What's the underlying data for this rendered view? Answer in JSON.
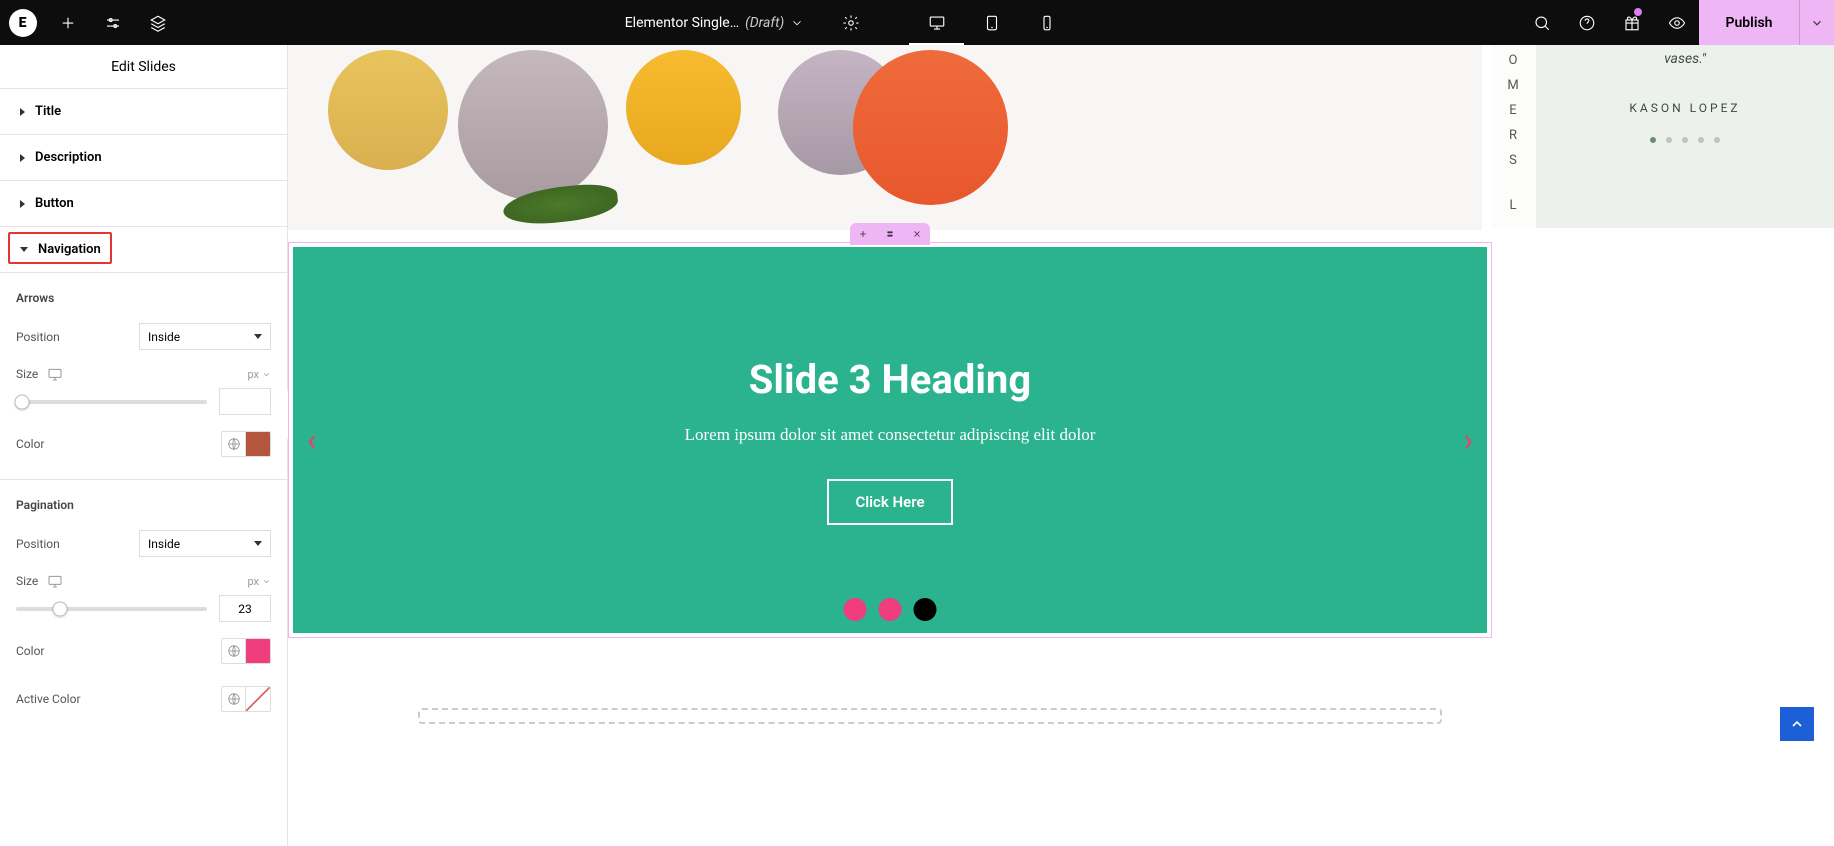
{
  "topbar": {
    "logo": "E",
    "title": "Elementor Single…",
    "status": "(Draft)",
    "publish": "Publish"
  },
  "sidebar": {
    "title": "Edit Slides",
    "accordions": {
      "title": "Title",
      "description": "Description",
      "button": "Button",
      "navigation": "Navigation"
    },
    "arrows": {
      "heading": "Arrows",
      "position_label": "Position",
      "position_value": "Inside",
      "size_label": "Size",
      "size_unit": "px",
      "size_value": "",
      "color_label": "Color",
      "color_hex": "#b4563d"
    },
    "pagination": {
      "heading": "Pagination",
      "position_label": "Position",
      "position_value": "Inside",
      "size_label": "Size",
      "size_unit": "px",
      "size_value": "23",
      "color_label": "Color",
      "color_hex": "#ef3d7e",
      "active_color_label": "Active Color"
    }
  },
  "slide": {
    "heading": "Slide 3 Heading",
    "text": "Lorem ipsum dolor sit amet consectetur adipiscing elit dolor",
    "button": "Click Here"
  },
  "testimonial": {
    "quote": "vases.\"",
    "name": "KASON LOPEZ"
  },
  "vertical_letters": [
    "O",
    "M",
    "E",
    "R",
    "S",
    "",
    "L"
  ]
}
